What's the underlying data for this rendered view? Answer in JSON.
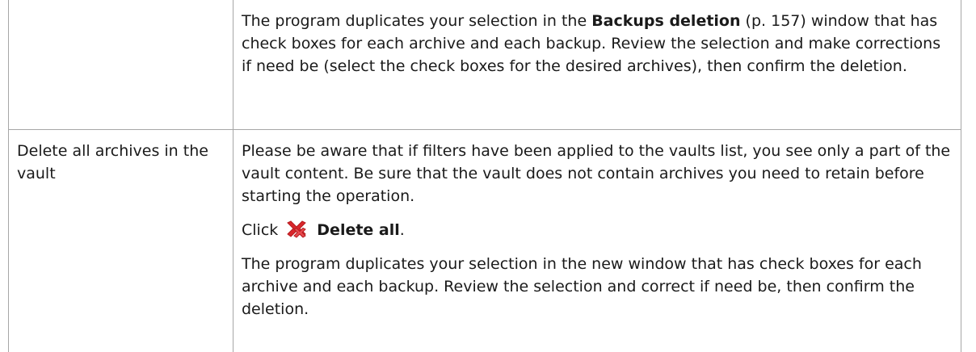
{
  "row1": {
    "left": "",
    "text_before_bold": "The program duplicates your selection in the ",
    "bold": "Backups deletion",
    "text_after_bold": " (p. 157) window that has check boxes for each archive and each backup. Review the selection and make corrections if need be (select the check boxes for the desired archives), then confirm the deletion."
  },
  "row2": {
    "left": "Delete all archives in the vault",
    "para1": "Please be aware that if filters have been applied to the vaults list, you see only a part of the vault content. Be sure that the vault does not contain archives you need to retain before starting the operation.",
    "click_prefix": "Click",
    "click_icon": "delete-all-icon",
    "click_bold": "Delete all",
    "click_suffix": ".",
    "para3": "The program duplicates your selection in the new window that has check boxes for each archive and each backup. Review the selection and correct if need be, then confirm the deletion."
  },
  "colors": {
    "border": "#a6a6a6",
    "icon_red": "#d9262b"
  }
}
